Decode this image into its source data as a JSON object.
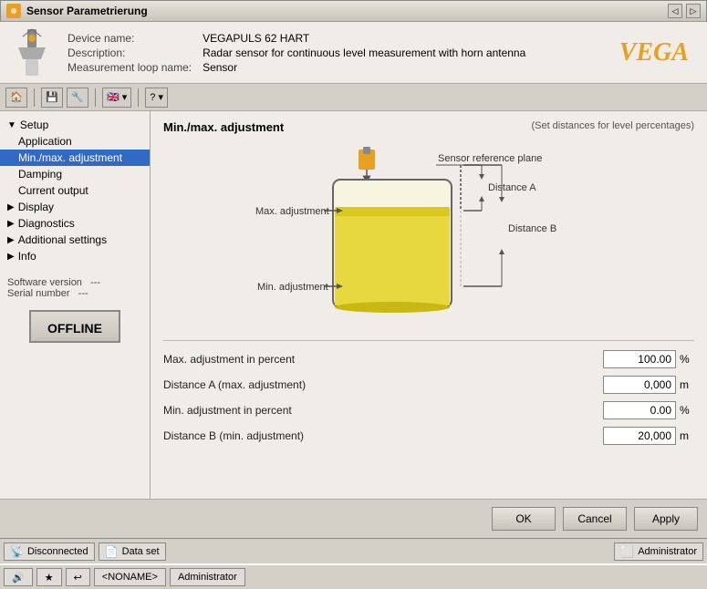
{
  "titleBar": {
    "title": "Sensor Parametrierung",
    "icon": "sensor-icon",
    "controls": [
      "back",
      "forward"
    ]
  },
  "deviceInfo": {
    "deviceName_label": "Device name:",
    "deviceName_value": "VEGAPULS 62 HART",
    "description_label": "Description:",
    "description_value": "Radar sensor for continuous level measurement with horn antenna",
    "loopName_label": "Measurement loop name:",
    "loopName_value": "Sensor",
    "logo": "VEGA"
  },
  "toolbar": {
    "buttons": [
      "home",
      "save",
      "settings",
      "flag",
      "help"
    ]
  },
  "sidebar": {
    "items": [
      {
        "id": "setup",
        "label": "Setup",
        "level": 0,
        "expandable": true
      },
      {
        "id": "application",
        "label": "Application",
        "level": 1
      },
      {
        "id": "min-max",
        "label": "Min./max. adjustment",
        "level": 1,
        "selected": true
      },
      {
        "id": "damping",
        "label": "Damping",
        "level": 1
      },
      {
        "id": "current-output",
        "label": "Current output",
        "level": 1
      },
      {
        "id": "display",
        "label": "Display",
        "level": 0,
        "expandable": true
      },
      {
        "id": "diagnostics",
        "label": "Diagnostics",
        "level": 0,
        "expandable": true
      },
      {
        "id": "additional",
        "label": "Additional settings",
        "level": 0,
        "expandable": true
      },
      {
        "id": "info",
        "label": "Info",
        "level": 0,
        "expandable": true
      }
    ],
    "softwareVersion_label": "Software version",
    "softwareVersion_value": "---",
    "serialNumber_label": "Serial number",
    "serialNumber_value": "---",
    "offlineBtn": "OFFLINE"
  },
  "content": {
    "title": "Min./max. adjustment",
    "subtitle": "(Set distances for level percentages)",
    "diagram": {
      "sensorReferencePlane": "Sensor reference plane",
      "maxAdjustment": "Max. adjustment",
      "minAdjustment": "Min. adjustment",
      "distanceA": "Distance A",
      "distanceB": "Distance B"
    },
    "fields": [
      {
        "label": "Max. adjustment in percent",
        "value": "100.00",
        "unit": "%"
      },
      {
        "label": "Distance A (max. adjustment)",
        "value": "0,000",
        "unit": "m"
      },
      {
        "label": "Min. adjustment in percent",
        "value": "0.00",
        "unit": "%"
      },
      {
        "label": "Distance B (min. adjustment)",
        "value": "20,000",
        "unit": "m"
      }
    ]
  },
  "buttons": {
    "ok": "OK",
    "cancel": "Cancel",
    "apply": "Apply"
  },
  "statusBar": {
    "disconnected": "Disconnected",
    "dataset": "Data set",
    "role": "Administrator"
  },
  "taskbar": {
    "name": "<NONAME>",
    "role": "Administrator"
  }
}
